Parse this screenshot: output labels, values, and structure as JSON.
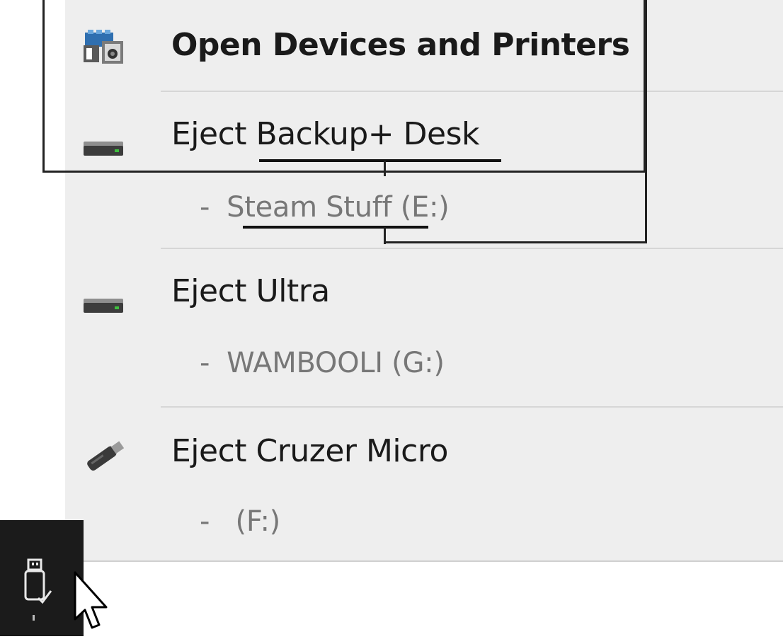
{
  "menu": {
    "items": [
      {
        "label": "Open Devices and Printers",
        "icon": "devices-printers-icon",
        "sub": null
      },
      {
        "label": "Eject Backup+  Desk",
        "icon": "external-drive-icon",
        "sub": "Steam Stuff (E:)"
      },
      {
        "label": "Eject Ultra",
        "icon": "external-drive-icon",
        "sub": "WAMBOOLI (G:)"
      },
      {
        "label": "Eject Cruzer Micro",
        "icon": "usb-flash-drive-icon",
        "sub": " (F:)"
      }
    ],
    "dash": "-"
  },
  "taskbar": {
    "tray_icon": "safely-remove-hardware-icon",
    "cursor": "mouse-pointer-icon"
  },
  "colors": {
    "flyout_bg": "#eeeeee",
    "taskbar_bg": "#1b1b1b",
    "sub_text": "#777777",
    "drive_led": "#3fbf3f"
  }
}
